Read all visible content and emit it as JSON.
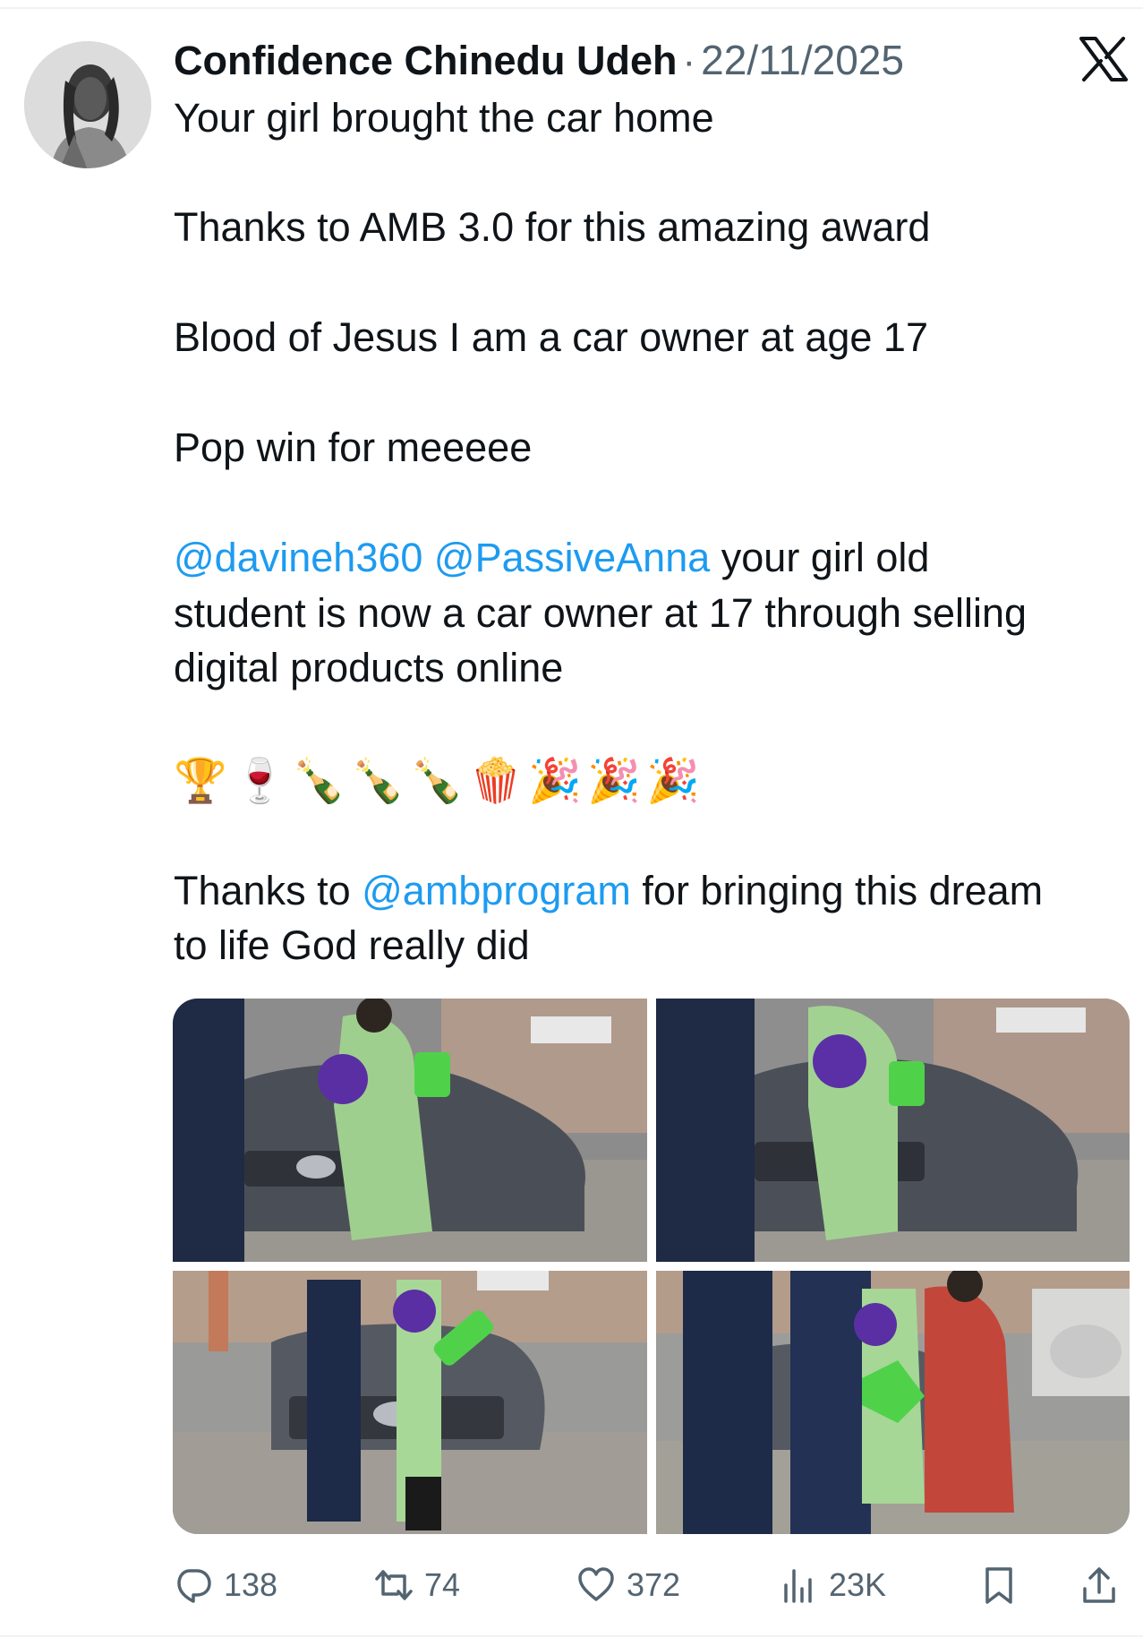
{
  "post": {
    "author_name": "Confidence Chinedu Udeh",
    "separator": "·",
    "date": "22/11/2025",
    "lines": {
      "l1": "Your girl brought the car home",
      "l2": "Thanks to AMB 3.0 for this amazing award",
      "l3": "Blood of Jesus I am a car owner at age 17",
      "l4": "Pop win for meeeee",
      "l5_mention_1": "@davineh360",
      "l5_mention_2": "@PassiveAnna",
      "l5_text": " your girl  old",
      "l6": "student is now a car owner at 17 through selling",
      "l7": "digital products online",
      "l8_prefix": "Thanks to ",
      "l8_mention": "@ambprogram",
      "l8_suffix": " for bringing this dream",
      "l9": "to life God really did"
    },
    "emojis": [
      "🏆",
      "🍷",
      "🍾",
      "🍾",
      "🍾",
      "🍿",
      "🎉",
      "🎉",
      "🎉"
    ]
  },
  "actions": {
    "reply_count": "138",
    "repost_count": "74",
    "like_count": "372",
    "views_count": "23K"
  },
  "icons": {
    "platform": "x-logo-icon",
    "reply": "reply-icon",
    "repost": "repost-icon",
    "like": "heart-icon",
    "views": "views-icon",
    "bookmark": "bookmark-icon",
    "share": "share-icon"
  },
  "colors": {
    "text": "#0f1419",
    "secondary": "#536471",
    "mention": "#1d9bf0",
    "divider": "#eff3f4"
  }
}
